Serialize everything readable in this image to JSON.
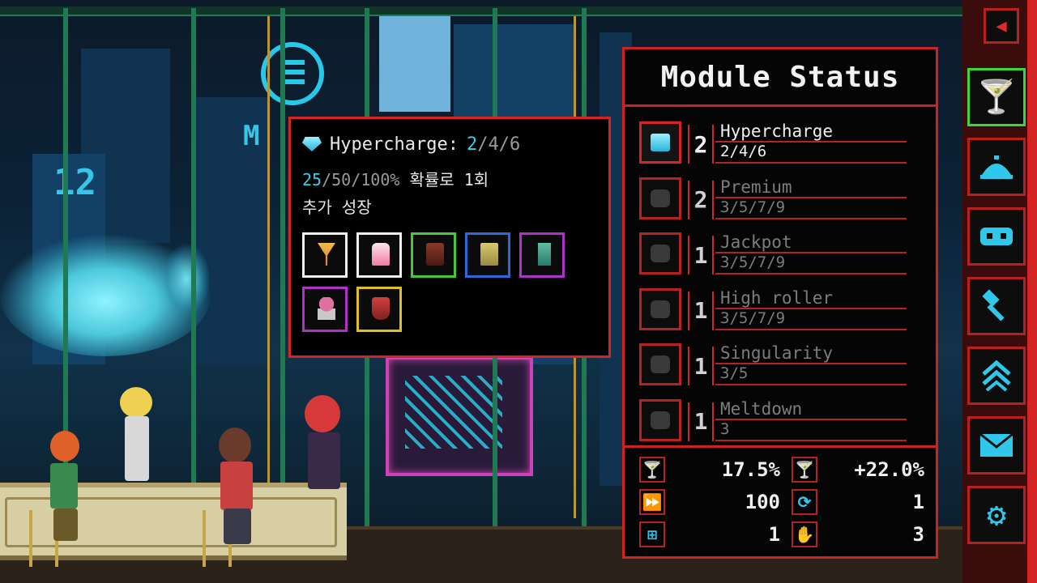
{
  "tooltip": {
    "title_name": "Hypercharge:",
    "title_current": "2",
    "title_rest": "/4/6",
    "desc_highlight": "25",
    "desc_rest": "/50/100%",
    "desc_line1_text": "확률로 1회",
    "desc_line2": "추가 성장",
    "drinks": [
      {
        "icon": "cocktail-glass-icon",
        "border": "#f0f0f0"
      },
      {
        "icon": "milkshake-icon",
        "border": "#f0f0f0"
      },
      {
        "icon": "jar-drink-icon",
        "border": "#46c83a"
      },
      {
        "icon": "tumbler-icon",
        "border": "#2a6ad8"
      },
      {
        "icon": "tall-glass-icon",
        "border": "#b032c8"
      },
      {
        "icon": "ice-cream-drink-icon",
        "border": "#b032c8"
      },
      {
        "icon": "red-flask-icon",
        "border": "#e0c020"
      }
    ]
  },
  "module_panel": {
    "title": "Module Status",
    "modules": [
      {
        "level": "2",
        "name": "Hypercharge",
        "values": "2/4/6",
        "active": true,
        "icon": "hypercharge-gem-icon"
      },
      {
        "level": "2",
        "name": "Premium",
        "values": "3/5/7/9",
        "active": false,
        "icon": "premium-icon"
      },
      {
        "level": "1",
        "name": "Jackpot",
        "values": "3/5/7/9",
        "active": false,
        "icon": "jackpot-icon"
      },
      {
        "level": "1",
        "name": "High roller",
        "values": "3/5/7/9",
        "active": false,
        "icon": "high-roller-hat-icon"
      },
      {
        "level": "1",
        "name": "Singularity",
        "values": "3/5",
        "active": false,
        "icon": "singularity-icon"
      },
      {
        "level": "1",
        "name": "Meltdown",
        "values": "3",
        "active": false,
        "icon": "meltdown-icon"
      }
    ],
    "stats": {
      "drink_chance": "17.5%",
      "bonus_percent": "+22.0%",
      "speed": "100",
      "refresh": "1",
      "plus": "1",
      "hand": "3"
    }
  },
  "sidebar": {
    "items": [
      {
        "icon": "cocktail-icon",
        "selected": true
      },
      {
        "icon": "cloche-icon",
        "selected": false
      },
      {
        "icon": "robot-icon",
        "selected": false
      },
      {
        "icon": "hammer-icon",
        "selected": false
      },
      {
        "icon": "upgrade-chevrons-icon",
        "selected": false
      },
      {
        "icon": "mail-icon",
        "selected": false
      },
      {
        "icon": "gear-icon",
        "selected": false
      }
    ]
  },
  "colors": {
    "panel_border": "#cc2222",
    "accent_cyan": "#30d0e8",
    "selected_green": "#38d83a",
    "inactive_text": "#7d7d7d"
  }
}
